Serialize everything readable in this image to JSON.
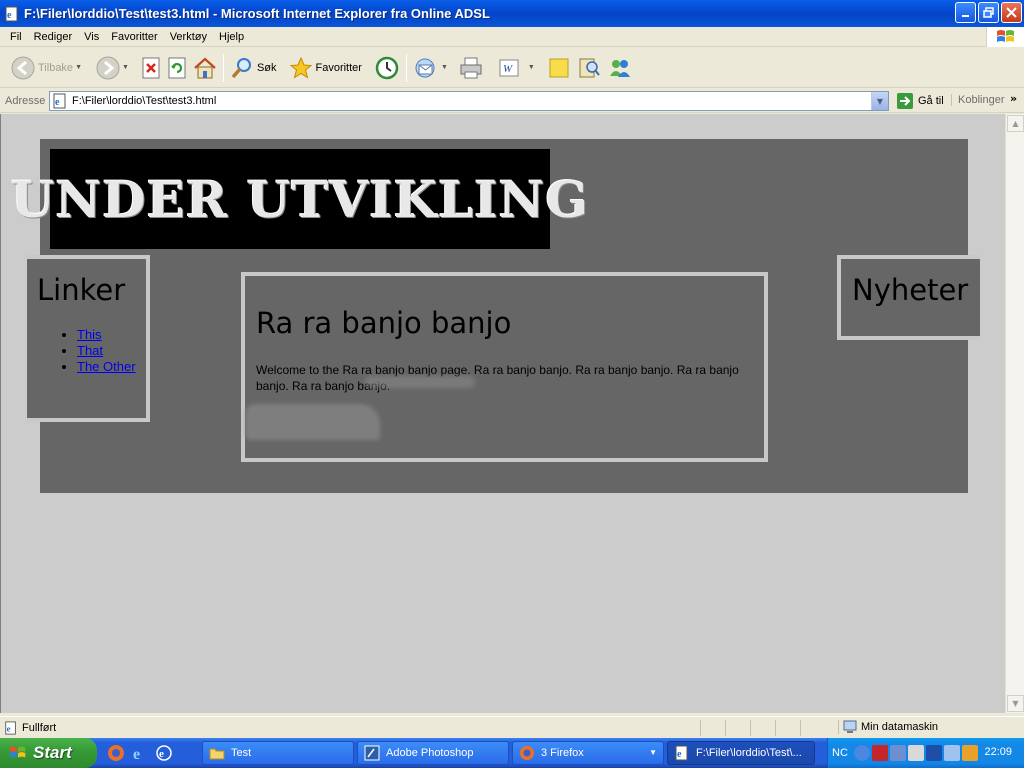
{
  "window": {
    "title": "F:\\Filer\\lorddio\\Test\\test3.html - Microsoft Internet Explorer fra Online ADSL"
  },
  "menu": [
    "Fil",
    "Rediger",
    "Vis",
    "Favoritter",
    "Verktøy",
    "Hjelp"
  ],
  "toolbar": {
    "back_label": "Tilbake",
    "search_label": "Søk",
    "favorites_label": "Favoritter"
  },
  "address": {
    "label": "Adresse",
    "value": "F:\\Filer\\lorddio\\Test\\test3.html",
    "go_label": "Gå til",
    "links_label": "Koblinger"
  },
  "page": {
    "banner_text": "UNDER UTVIKLING",
    "left": {
      "heading": "Linker",
      "links": [
        "This",
        "That",
        "The Other"
      ]
    },
    "main": {
      "heading": "Ra ra banjo banjo",
      "paragraph": "Welcome to the Ra ra banjo banjo page. Ra ra banjo banjo. Ra ra banjo banjo. Ra ra banjo banjo. Ra ra banjo banjo."
    },
    "right": {
      "heading": "Nyheter"
    }
  },
  "status": {
    "text": "Fullført",
    "zone": "Min datamaskin"
  },
  "taskbar": {
    "start_label": "Start",
    "tasks": [
      "Test",
      "Adobe Photoshop",
      "3 Firefox",
      "F:\\Filer\\lorddio\\Test\\..."
    ],
    "tray_nc": "NC",
    "clock": "22:09"
  }
}
